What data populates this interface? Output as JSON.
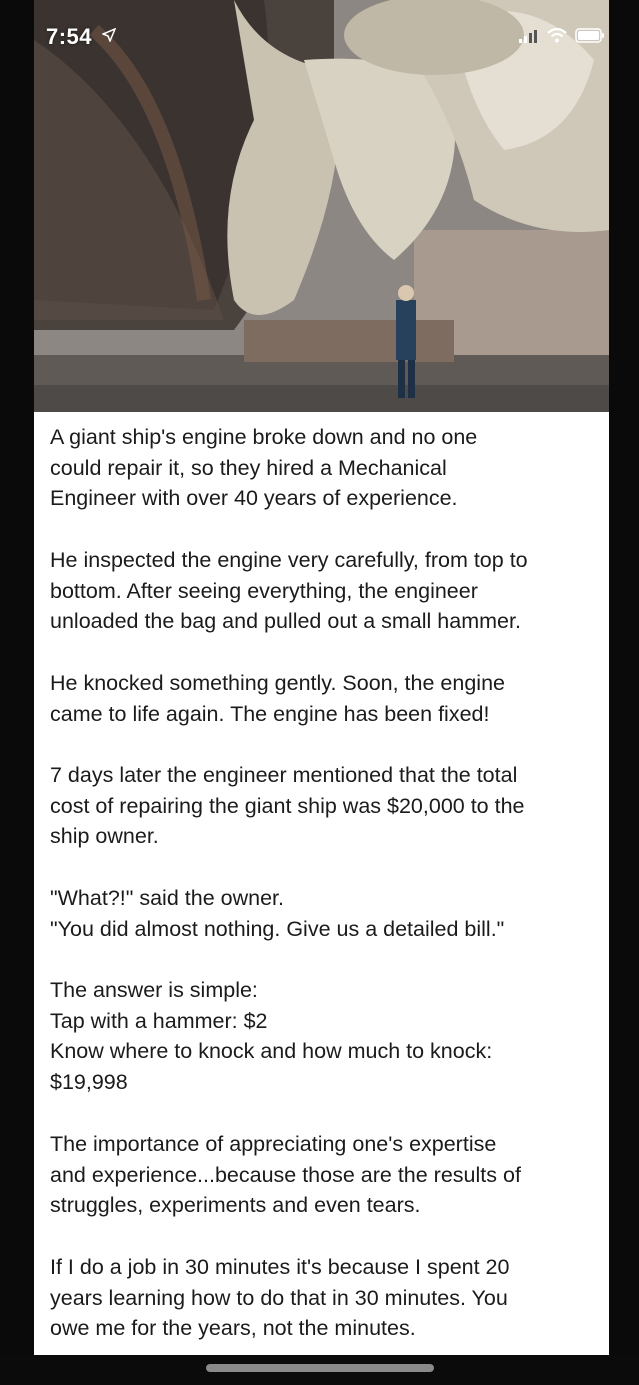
{
  "status_bar": {
    "time": "7:54",
    "location_icon": "location-arrow-icon",
    "signal_icon": "signal-bars-icon",
    "wifi_icon": "wifi-icon",
    "battery_icon": "battery-icon"
  },
  "photo": {
    "subject_icon": "ship-propeller-photo"
  },
  "post": {
    "paragraphs": [
      "A giant ship's engine broke down and no one\ncould repair it, so they hired a Mechanical\nEngineer with over 40 years of experience.",
      "He inspected the engine very carefully, from top to\nbottom. After seeing everything, the engineer\nunloaded the bag and pulled out a small hammer.",
      "He knocked something gently. Soon, the engine\ncame to life again. The engine has been fixed!",
      "7 days later the engineer mentioned that the total\ncost of repairing the giant ship was $20,000 to the\nship owner.",
      "\"What?!\" said the owner.\n\"You did almost nothing. Give us a detailed bill.\"",
      "The answer is simple:\nTap with a hammer: $2\nKnow where to knock and how much to knock:\n$19,998",
      "The importance of appreciating one's expertise\nand experience...because those are the results of\nstruggles, experiments and even tears.",
      "If I do a job in 30 minutes it's because I spent 20\nyears learning how to do that in 30 minutes. You\nowe me for the years, not the minutes."
    ]
  },
  "colors": {
    "text": "#1b1b1b",
    "card_bg": "#ffffff",
    "screen_bg": "#0a0a0a"
  }
}
